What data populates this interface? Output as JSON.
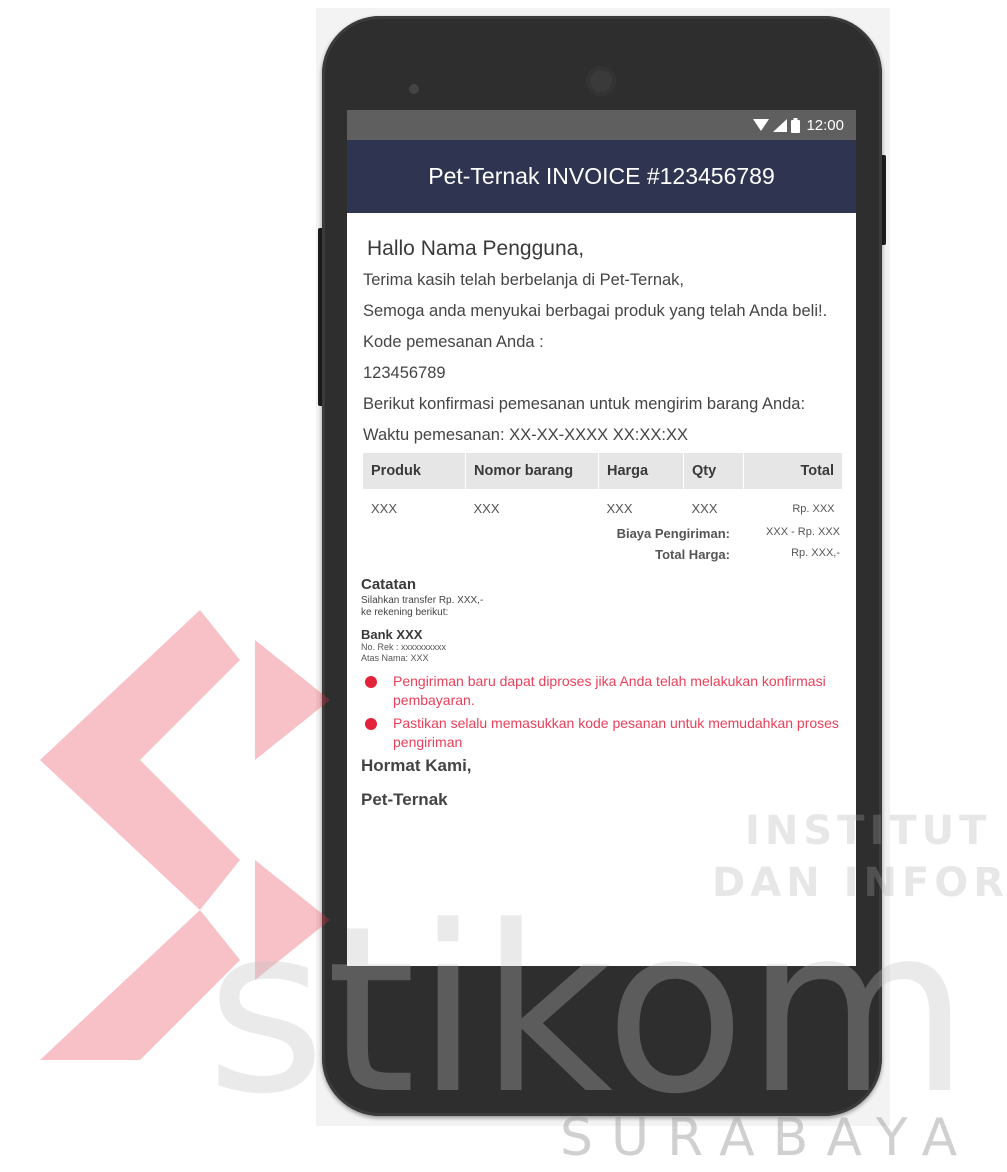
{
  "status_bar": {
    "time": "12:00",
    "icons": [
      "wifi-icon",
      "signal-icon",
      "battery-icon"
    ]
  },
  "app_bar": {
    "title": "Pet-Ternak INVOICE #123456789"
  },
  "greeting": "Hallo Nama Pengguna,",
  "paragraphs": {
    "thanks": "Terima kasih telah berbelanja di Pet-Ternak,",
    "hope": "Semoga anda menyukai berbagai produk yang telah Anda beli!.",
    "code_label": "Kode pemesanan Anda :",
    "code_value": "123456789",
    "confirm": "Berikut konfirmasi pemesanan untuk mengirim barang Anda:",
    "time": "Waktu pemesanan: XX-XX-XXXX XX:XX:XX"
  },
  "table": {
    "headers": [
      "Produk",
      "Nomor barang",
      "Harga",
      "Qty",
      "Total"
    ],
    "rows": [
      [
        "XXX",
        "XXX",
        "XXX",
        "XXX",
        "Rp. XXX"
      ]
    ]
  },
  "summary": {
    "shipping_label": "Biaya Pengiriman:",
    "shipping_value": "XXX - Rp. XXX",
    "total_label": "Total Harga:",
    "total_value": "Rp. XXX,-"
  },
  "notes": {
    "title": "Catatan",
    "line1": "Silahkan transfer Rp. XXX,-",
    "line2": "ke rekening berikut:",
    "bank": "Bank XXX",
    "account": "No. Rek : xxxxxxxxxx",
    "holder": "Atas Nama: XXX",
    "warnings": [
      "Pengiriman baru dapat diproses jika Anda telah melakukan konfirmasi pembayaran.",
      "Pastikan selalu memasukkan kode pesanan untuk memudahkan proses pengiriman"
    ]
  },
  "closing": {
    "regards": "Hormat Kami,",
    "signature": "Pet-Ternak"
  },
  "watermark": {
    "line1": "INSTITUT BISNIS",
    "line2": "DAN INFORMATIKA",
    "brand": "stikom",
    "city": "SURABAYA"
  },
  "colors": {
    "app_bar": "#2f3450",
    "status_bar": "#5f5f5f",
    "warning_text": "#e8405a",
    "logo_red": "#e7334a"
  }
}
